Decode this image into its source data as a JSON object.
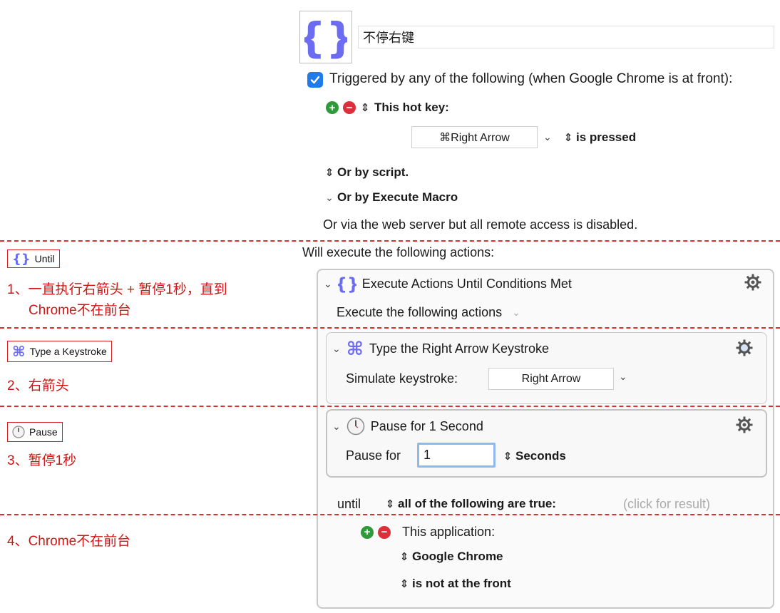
{
  "header": {
    "macro_name": "不停右键",
    "macro_icon": "curly-braces-icon"
  },
  "trigger": {
    "checkbox_label": "Triggered by any of the following (when Google Chrome is at front):",
    "hotkey_label": "This hot key:",
    "hotkey_value": "⌘Right Arrow",
    "hotkey_condition": "is pressed",
    "by_script": "Or by script.",
    "by_execute_macro": "Or by Execute Macro",
    "web_server_note": "Or via the web server but all remote access is disabled."
  },
  "actions": {
    "heading": "Will execute the following actions:",
    "until_block": {
      "title": "Execute Actions Until Conditions Met",
      "subtitle": "Execute the following actions",
      "keystroke": {
        "title": "Type the Right Arrow Keystroke",
        "simulate_label": "Simulate keystroke:",
        "key_value": "Right Arrow"
      },
      "pause": {
        "title": "Pause for 1 Second",
        "pause_label": "Pause for",
        "pause_value": "1",
        "unit": "Seconds"
      },
      "until_label": "until",
      "condition_mode": "all of the following are true:",
      "click_result": "(click for result)",
      "condition": {
        "label": "This application:",
        "app": "Google Chrome",
        "state": "is not at the front"
      }
    }
  },
  "annotations": {
    "tag_until": "Until",
    "note1_line1": "1、一直执行右箭头 + 暂停1秒，直到",
    "note1_line2": "Chrome不在前台",
    "tag_keystroke": "Type a Keystroke",
    "note2": "2、右箭头",
    "tag_pause": "Pause",
    "note3": "3、暂停1秒",
    "note4": "4、Chrome不在前台"
  },
  "colors": {
    "accent_blue": "#1f7aea",
    "annotation_red": "#d01515",
    "icon_purple": "#6b6cf2"
  }
}
